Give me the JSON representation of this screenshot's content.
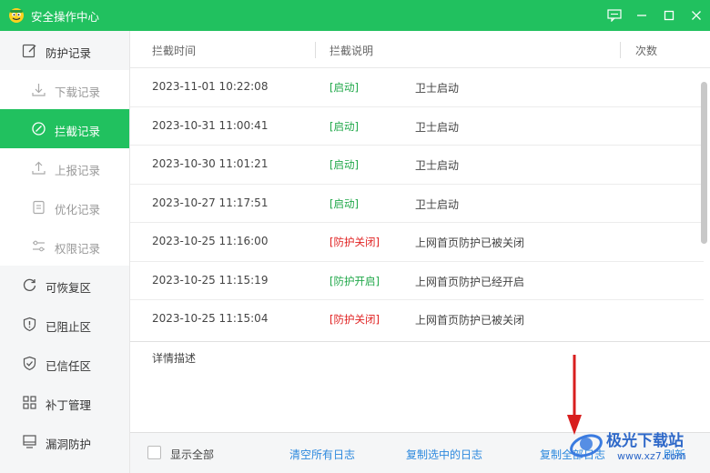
{
  "window": {
    "title": "安全操作中心"
  },
  "sidebar": {
    "group_protect": "防护记录",
    "sub_items": [
      {
        "label": "下载记录",
        "icon": "download-icon"
      },
      {
        "label": "拦截记录",
        "icon": "block-icon"
      },
      {
        "label": "上报记录",
        "icon": "upload-icon"
      },
      {
        "label": "优化记录",
        "icon": "clipboard-icon"
      },
      {
        "label": "权限记录",
        "icon": "sliders-icon"
      }
    ],
    "groups": [
      {
        "label": "可恢复区",
        "icon": "restore-icon"
      },
      {
        "label": "已阻止区",
        "icon": "shield-alert-icon"
      },
      {
        "label": "已信任区",
        "icon": "shield-check-icon"
      },
      {
        "label": "补丁管理",
        "icon": "apps-grid-icon"
      },
      {
        "label": "漏洞防护",
        "icon": "monitor-shield-icon"
      }
    ]
  },
  "table": {
    "col_time": "拦截时间",
    "col_desc": "拦截说明",
    "col_count": "次数",
    "rows": [
      {
        "time": "2023-11-01 10:22:08",
        "status": "[启动]",
        "status_color": "#21a84a",
        "desc": "卫士启动"
      },
      {
        "time": "2023-10-31 11:00:41",
        "status": "[启动]",
        "status_color": "#21a84a",
        "desc": "卫士启动"
      },
      {
        "time": "2023-10-30 11:01:21",
        "status": "[启动]",
        "status_color": "#21a84a",
        "desc": "卫士启动"
      },
      {
        "time": "2023-10-27 11:17:51",
        "status": "[启动]",
        "status_color": "#21a84a",
        "desc": "卫士启动"
      },
      {
        "time": "2023-10-25 11:16:00",
        "status": "[防护关闭]",
        "status_color": "#e02020",
        "desc": "上网首页防护已被关闭"
      },
      {
        "time": "2023-10-25 11:15:19",
        "status": "[防护开启]",
        "status_color": "#21a84a",
        "desc": "上网首页防护已经开启"
      },
      {
        "time": "2023-10-25 11:15:04",
        "status": "[防护关闭]",
        "status_color": "#e02020",
        "desc": "上网首页防护已被关闭"
      }
    ]
  },
  "detail": {
    "label": "详情描述"
  },
  "footer": {
    "show_all": "显示全部",
    "clear_all": "清空所有日志",
    "copy_selected": "复制选中的日志",
    "copy_all": "复制全部日志",
    "refresh": "刷新"
  },
  "watermark": {
    "text": "极光下载站",
    "url": "www.xz7.com"
  },
  "colors": {
    "accent": "#21c15f",
    "link": "#2d89de"
  }
}
